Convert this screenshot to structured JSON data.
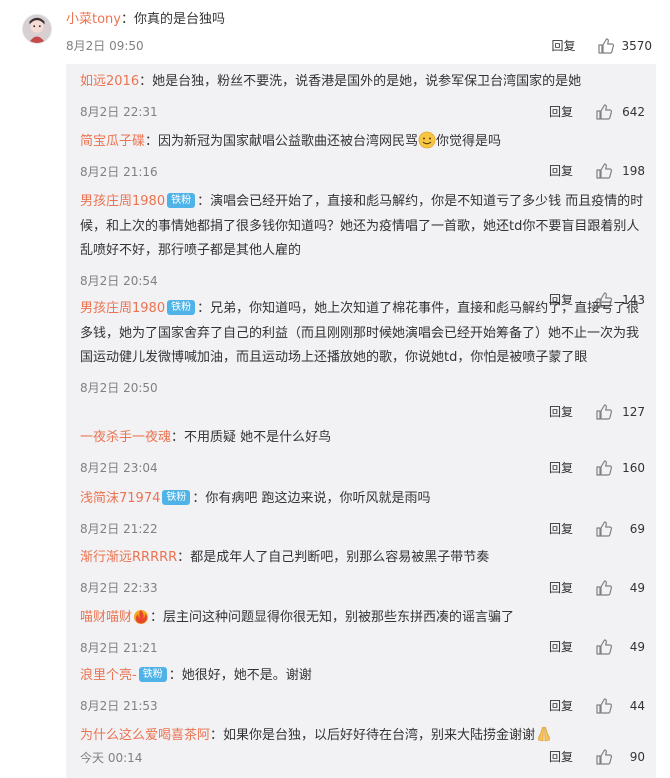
{
  "main_comment": {
    "user": "小菜tony",
    "separator": "：",
    "text": "你真的是台独吗",
    "time": "8月2日 09:50",
    "reply_label": "回复",
    "likes": "3570"
  },
  "sub_comments": [
    {
      "user": "如远2016",
      "badge": "",
      "sep": "：",
      "text": "她是台独，粉丝不要洗，说香港是国外的是她，说参军保卫台湾国家的是她",
      "time": "8月2日 22:31",
      "reply_label": "回复",
      "likes": "642"
    },
    {
      "user": "简宝瓜子碟",
      "badge": "",
      "sep": "：",
      "text": "因为新冠为国家献唱公益歌曲还被台湾网民骂",
      "text_after_emoji": "你觉得是吗",
      "time": "8月2日 21:16",
      "reply_label": "回复",
      "likes": "198"
    },
    {
      "user": "男孩庄周1980",
      "badge": "铁粉",
      "sep": "：",
      "text": "演唱会已经开始了，直接和彪马解约，你是不知道亏了多少钱 而且疫情的时候，和上次的事情她都捐了很多钱你知道吗？她还为疫情唱了一首歌，她还td你不要盲目跟着别人乱喷好不好，那行喷子都是其他人雇的",
      "time": "8月2日 20:54",
      "reply_label": "回复",
      "likes": "143"
    },
    {
      "user": "男孩庄周1980",
      "badge": "铁粉",
      "sep": "：",
      "text": "兄弟，你知道吗，她上次知道了棉花事件，直接和彪马解约了，直接亏了很多钱，她为了国家舍弃了自己的利益（而且刚刚那时候她演唱会已经开始筹备了）她不止一次为我国运动健儿发微博喊加油，而且运动场上还播放她的歌，你说她td，你怕是被喷子蒙了眼",
      "time": "8月2日 20:50",
      "reply_label": "回复",
      "likes": "127"
    },
    {
      "user": "一夜杀手一夜魂",
      "badge": "",
      "sep": "：",
      "text": "不用质疑 她不是什么好鸟",
      "time": "8月2日 23:04",
      "reply_label": "回复",
      "likes": "160"
    },
    {
      "user": "浅简沫71974",
      "badge": "铁粉",
      "sep": "：",
      "text": "你有病吧 跑这边来说，你听风就是雨吗",
      "time": "8月2日 21:22",
      "reply_label": "回复",
      "likes": "69"
    },
    {
      "user": "渐行渐远RRRRR",
      "badge": "",
      "sep": "：",
      "text": "都是成年人了自己判断吧，别那么容易被黑子带节奏",
      "time": "8月2日 22:33",
      "reply_label": "回复",
      "likes": "49"
    },
    {
      "user": "喵财喵财",
      "badge": "",
      "sep": "：",
      "text": "层主问这种问题显得你很无知，别被那些东拼西凑的谣言骗了",
      "time": "8月2日 21:21",
      "reply_label": "回复",
      "likes": "49"
    },
    {
      "user": "浪里个亮-",
      "badge": "铁粉",
      "sep": "：",
      "text": "她很好，她不是。谢谢",
      "time": "8月2日 21:53",
      "reply_label": "回复",
      "likes": "44"
    },
    {
      "user": "为什么这么爱喝喜茶阿",
      "badge": "",
      "sep": "：",
      "text": "如果你是台独，以后好好待在台湾，别来大陆捞金谢谢",
      "time": "今天 00:14",
      "reply_label": "回复",
      "likes": "90"
    }
  ],
  "colors": {
    "username": "#eb7350",
    "text": "#333333",
    "time": "#808080",
    "sub_bg": "#f2f2f5",
    "badge_bg": "#4fb3e8"
  },
  "icons": [
    "thumbs-up-icon",
    "smile-emoji-icon",
    "praying-hands-emoji-icon",
    "fire-badge-icon"
  ]
}
